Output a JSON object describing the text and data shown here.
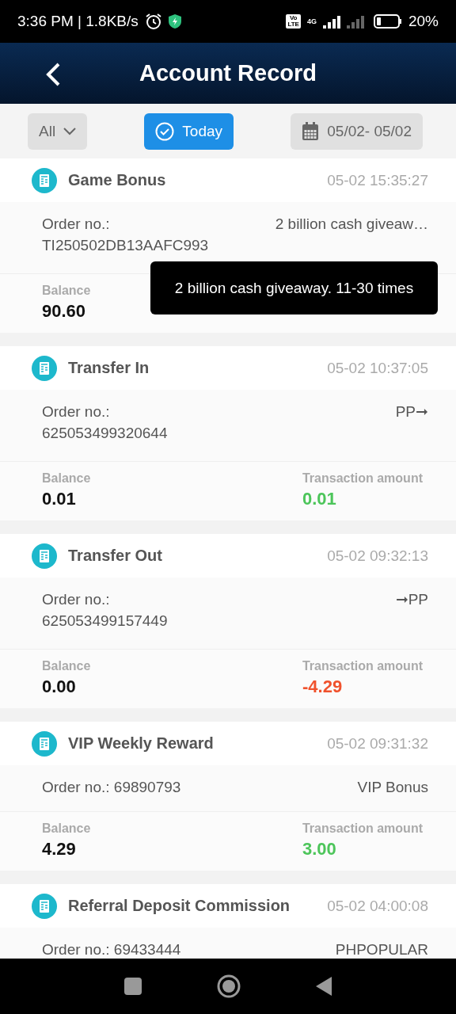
{
  "status_bar": {
    "time": "3:36 PM | 1.8KB/s",
    "volte": [
      "Vo",
      "LTE"
    ],
    "network": "4G",
    "battery": "20%"
  },
  "header": {
    "title": "Account Record"
  },
  "filters": {
    "type": {
      "label": "All"
    },
    "today": {
      "label": "Today",
      "selected": true
    },
    "date_range": {
      "label": "05/02- 05/02"
    }
  },
  "records": [
    {
      "title": "Game Bonus",
      "time": "05-02 15:35:27",
      "order_lines": [
        "Order no.:",
        "TI250502DB13AAFC993"
      ],
      "note": "2 billion cash giveaw…",
      "balance_label": "Balance",
      "balance": "90.60"
    },
    {
      "title": "Transfer In",
      "time": "05-02 10:37:05",
      "order_lines": [
        "Order no.:",
        "625053499320644"
      ],
      "note": "PP➞",
      "balance_label": "Balance",
      "balance": "0.01",
      "amount_label": "Transaction amount",
      "amount": "0.01",
      "color": "#4cc55a"
    },
    {
      "title": "Transfer Out",
      "time": "05-02 09:32:13",
      "order_lines": [
        "Order no.:",
        "625053499157449"
      ],
      "note": "➞PP",
      "balance_label": "Balance",
      "balance": "0.00",
      "amount_label": "Transaction amount",
      "amount": "-4.29",
      "color": "#f0522d"
    },
    {
      "title": "VIP Weekly Reward",
      "time": "05-02 09:31:32",
      "order_lines": [
        "Order no.: 69890793"
      ],
      "note": "VIP Bonus",
      "balance_label": "Balance",
      "balance": "4.29",
      "amount_label": "Transaction amount",
      "amount": "3.00",
      "color": "#4cc55a"
    },
    {
      "title": "Referral Deposit Commission",
      "time": "05-02 04:00:08",
      "order_lines": [
        "Order no.: 69433444"
      ],
      "note": "PHPOPULAR"
    }
  ],
  "tooltip": {
    "text": "2 billion cash giveaway. 11-30 times"
  }
}
